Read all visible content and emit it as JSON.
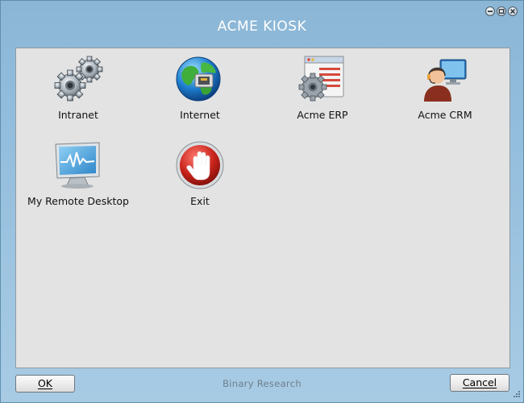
{
  "window": {
    "title": "ACME KIOSK",
    "controls": [
      "minimize-icon",
      "maximize-icon",
      "close-icon"
    ]
  },
  "apps": [
    {
      "label": "Intranet",
      "icon": "gears-icon"
    },
    {
      "label": "Internet",
      "icon": "globe-icon"
    },
    {
      "label": "Acme ERP",
      "icon": "erp-window-icon"
    },
    {
      "label": "Acme CRM",
      "icon": "crm-agent-icon"
    },
    {
      "label": "My Remote Desktop",
      "icon": "monitor-icon"
    },
    {
      "label": "Exit",
      "icon": "stop-hand-icon"
    }
  ],
  "footer": {
    "ok_label": "OK",
    "cancel_label": "Cancel",
    "brand": "Binary Research"
  },
  "colors": {
    "frame": "#94bedd",
    "content_bg": "#e3e3e3",
    "exit_red": "#c8231b"
  }
}
